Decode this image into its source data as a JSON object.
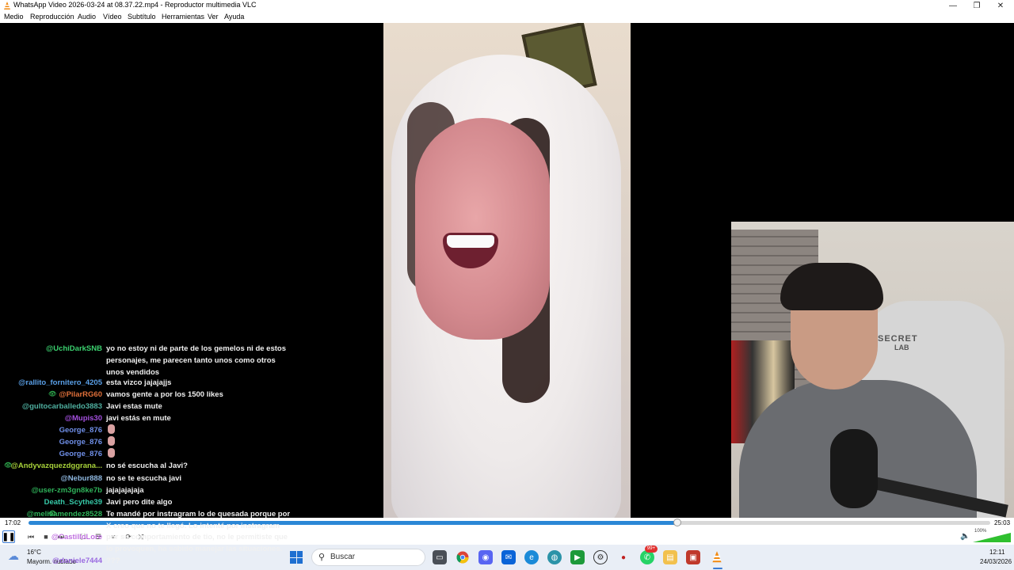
{
  "window": {
    "title": "WhatsApp Video 2026-03-24 at 08.37.22.mp4 - Reproductor multimedia VLC",
    "controls": {
      "minimize": "—",
      "restore": "❐",
      "close": "✕"
    }
  },
  "menu": [
    "Medio",
    "Reproducción",
    "Audio",
    "Vídeo",
    "Subtítulo",
    "Herramientas",
    "Ver",
    "Ayuda"
  ],
  "video": {
    "chair_brand_top": "SECRET",
    "chair_brand_bottom": "LAB"
  },
  "chat": [
    {
      "user": "@UchiDarkSNB",
      "user_color": "#3bd16f",
      "message": "yo no estoy ni de parte de los gemelos ni de estos personajes, me parecen tanto unos como otros unos vendidos",
      "multiline": true
    },
    {
      "user": "@rallito_fornitero_4205",
      "user_color": "#5aa0e8",
      "message": "esta vizco jajajajjs"
    },
    {
      "user": "@PilarRG60",
      "user_color": "#e0703a",
      "message": "vamos gente a por los 1500 likes",
      "mod": true
    },
    {
      "user": "@gultocarballedo3883",
      "user_color": "#4fb0a0",
      "message": "Javi estas mute"
    },
    {
      "user": "@Mupis30",
      "user_color": "#a550e0",
      "message": "javi estás en mute"
    },
    {
      "user": "George_876",
      "user_color": "#6f8fe8",
      "message": "",
      "emote": true
    },
    {
      "user": "George_876",
      "user_color": "#6f8fe8",
      "message": "",
      "emote": true
    },
    {
      "user": "George_876",
      "user_color": "#6f8fe8",
      "message": "",
      "emote": true
    },
    {
      "user": "@Andyvazquezdggrana...",
      "user_color": "#a8d23a",
      "message": "no sé escucha al Javi?",
      "mod": true
    },
    {
      "user": "@Nebur888",
      "user_color": "#8fb8e0",
      "message": "no se te escucha javi"
    },
    {
      "user": "@user-zm3gn8ke7b",
      "user_color": "#2fb35a",
      "message": "jajajajajaja"
    },
    {
      "user": "Death_Scythe39",
      "user_color": "#36c9a8",
      "message": "Javi pero dite algo"
    },
    {
      "user": "@melisamendez8528",
      "user_color": "#2fb35a",
      "message": "Te mandé por instragram lo de quesada porque por X creo que no te llegó. Lo intenté por instragram",
      "mod": true
    },
    {
      "user": "@CastilloLore",
      "user_color": "#c070e0",
      "message": "por su comportamiento de tio, no le permitiste que lo provoquen, ha sabido manejar las situaciones."
    },
    {
      "user": "@daniele7444",
      "user_color": "#9a6ae0",
      "message": "???"
    }
  ],
  "player": {
    "elapsed": "17:02",
    "total": "25:03",
    "progress": 0.675,
    "volume_label": "100%",
    "volume": 1.0,
    "buttons": [
      "pause",
      "previous",
      "stop",
      "next",
      "fullscreen",
      "extended-settings",
      "playlist",
      "loop",
      "shuffle"
    ]
  },
  "taskbar": {
    "weather_temp": "16°C",
    "weather_desc": "Mayorm. nublado",
    "search_placeholder": "Buscar",
    "notification_badge": "99+",
    "time": "12:11",
    "date": "24/03/2026"
  },
  "colors": {
    "seek_fill": "#2b87d6",
    "taskbar_bg": "#e9eef6"
  }
}
